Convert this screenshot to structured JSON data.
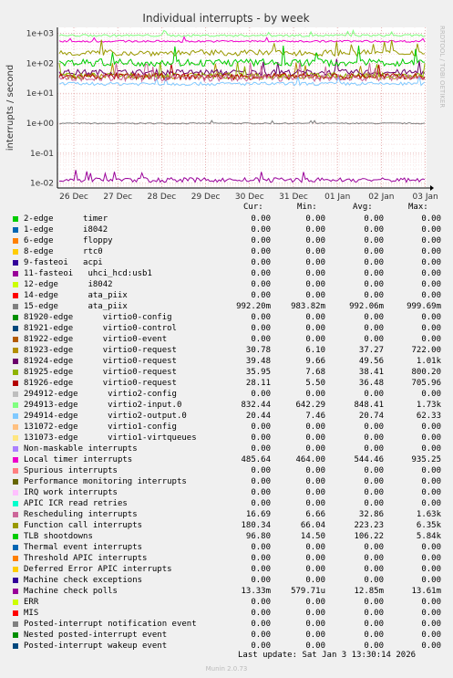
{
  "chart_data": {
    "type": "line",
    "title": "Individual interrupts - by week",
    "ylabel": "interrupts / second",
    "yscale": "log",
    "ylim": [
      0.007,
      2000
    ],
    "yticks": [
      "1e+03",
      "1e+02",
      "1e+01",
      "1e+00",
      "1e-01",
      "1e-02"
    ],
    "xticks": [
      "26 Dec",
      "27 Dec",
      "28 Dec",
      "29 Dec",
      "30 Dec",
      "31 Dec",
      "01 Jan",
      "02 Jan",
      "03 Jan"
    ],
    "watermark": "RRDTOOL / TOBI OETIKER",
    "grid": true,
    "columns": [
      "Cur:",
      "Min:",
      "Avg:",
      "Max:"
    ],
    "series": [
      {
        "name": "2-edge      timer",
        "color": "#00cc00",
        "values": [
          "0.00",
          "0.00",
          "0.00",
          "0.00"
        ]
      },
      {
        "name": "1-edge      i8042",
        "color": "#0066b3",
        "values": [
          "0.00",
          "0.00",
          "0.00",
          "0.00"
        ]
      },
      {
        "name": "6-edge      floppy",
        "color": "#ff8000",
        "values": [
          "0.00",
          "0.00",
          "0.00",
          "0.00"
        ]
      },
      {
        "name": "8-edge      rtc0",
        "color": "#ffcc00",
        "values": [
          "0.00",
          "0.00",
          "0.00",
          "0.00"
        ]
      },
      {
        "name": "9-fasteoi   acpi",
        "color": "#330099",
        "values": [
          "0.00",
          "0.00",
          "0.00",
          "0.00"
        ]
      },
      {
        "name": "11-fasteoi   uhci_hcd:usb1",
        "color": "#990099",
        "values": [
          "0.00",
          "0.00",
          "0.00",
          "0.00"
        ]
      },
      {
        "name": "12-edge      i8042",
        "color": "#ccff00",
        "values": [
          "0.00",
          "0.00",
          "0.00",
          "0.00"
        ]
      },
      {
        "name": "14-edge      ata_piix",
        "color": "#ff0000",
        "values": [
          "0.00",
          "0.00",
          "0.00",
          "0.00"
        ]
      },
      {
        "name": "15-edge      ata_piix",
        "color": "#808080",
        "values": [
          "992.20m",
          "983.82m",
          "992.06m",
          "999.69m"
        ]
      },
      {
        "name": "81920-edge      virtio0-config",
        "color": "#008f00",
        "values": [
          "0.00",
          "0.00",
          "0.00",
          "0.00"
        ]
      },
      {
        "name": "81921-edge      virtio0-control",
        "color": "#00487d",
        "values": [
          "0.00",
          "0.00",
          "0.00",
          "0.00"
        ]
      },
      {
        "name": "81922-edge      virtio0-event",
        "color": "#b35a00",
        "values": [
          "0.00",
          "0.00",
          "0.00",
          "0.00"
        ]
      },
      {
        "name": "81923-edge      virtio0-request",
        "color": "#b38f00",
        "values": [
          "30.78",
          "6.10",
          "37.27",
          "722.00"
        ]
      },
      {
        "name": "81924-edge      virtio0-request",
        "color": "#6b006b",
        "values": [
          "39.48",
          "9.66",
          "49.56",
          "1.01k"
        ]
      },
      {
        "name": "81925-edge      virtio0-request",
        "color": "#8fb300",
        "values": [
          "35.95",
          "7.68",
          "38.41",
          "800.20"
        ]
      },
      {
        "name": "81926-edge      virtio0-request",
        "color": "#b30000",
        "values": [
          "28.11",
          "5.50",
          "36.48",
          "705.96"
        ]
      },
      {
        "name": "294912-edge      virtio2-config",
        "color": "#bebebe",
        "values": [
          "0.00",
          "0.00",
          "0.00",
          "0.00"
        ]
      },
      {
        "name": "294913-edge      virtio2-input.0",
        "color": "#80ff80",
        "values": [
          "832.44",
          "642.29",
          "848.41",
          "1.73k"
        ]
      },
      {
        "name": "294914-edge      virtio2-output.0",
        "color": "#80c9ff",
        "values": [
          "20.44",
          "7.46",
          "20.74",
          "62.33"
        ]
      },
      {
        "name": "131072-edge      virtio1-config",
        "color": "#ffc080",
        "values": [
          "0.00",
          "0.00",
          "0.00",
          "0.00"
        ]
      },
      {
        "name": "131073-edge      virtio1-virtqueues",
        "color": "#ffe680",
        "values": [
          "0.00",
          "0.00",
          "0.00",
          "0.00"
        ]
      },
      {
        "name": "Non-maskable interrupts",
        "color": "#aa80ff",
        "values": [
          "0.00",
          "0.00",
          "0.00",
          "0.00"
        ]
      },
      {
        "name": "Local timer interrupts",
        "color": "#ee00cc",
        "values": [
          "485.64",
          "464.00",
          "544.46",
          "935.25"
        ]
      },
      {
        "name": "Spurious interrupts",
        "color": "#ff8080",
        "values": [
          "0.00",
          "0.00",
          "0.00",
          "0.00"
        ]
      },
      {
        "name": "Performance monitoring interrupts",
        "color": "#666600",
        "values": [
          "0.00",
          "0.00",
          "0.00",
          "0.00"
        ]
      },
      {
        "name": "IRQ work interrupts",
        "color": "#ffbfff",
        "values": [
          "0.00",
          "0.00",
          "0.00",
          "0.00"
        ]
      },
      {
        "name": "APIC ICR read retries",
        "color": "#00ffcc",
        "values": [
          "0.00",
          "0.00",
          "0.00",
          "0.00"
        ]
      },
      {
        "name": "Rescheduling interrupts",
        "color": "#cc6699",
        "values": [
          "16.69",
          "6.66",
          "32.86",
          "1.63k"
        ]
      },
      {
        "name": "Function call interrupts",
        "color": "#999900",
        "values": [
          "180.34",
          "66.04",
          "223.23",
          "6.35k"
        ]
      },
      {
        "name": "TLB shootdowns",
        "color": "#00cc00",
        "values": [
          "96.80",
          "14.50",
          "106.22",
          "5.84k"
        ]
      },
      {
        "name": "Thermal event interrupts",
        "color": "#0066b3",
        "values": [
          "0.00",
          "0.00",
          "0.00",
          "0.00"
        ]
      },
      {
        "name": "Threshold APIC interrupts",
        "color": "#ff8000",
        "values": [
          "0.00",
          "0.00",
          "0.00",
          "0.00"
        ]
      },
      {
        "name": "Deferred Error APIC interrupts",
        "color": "#ffcc00",
        "values": [
          "0.00",
          "0.00",
          "0.00",
          "0.00"
        ]
      },
      {
        "name": "Machine check exceptions",
        "color": "#330099",
        "values": [
          "0.00",
          "0.00",
          "0.00",
          "0.00"
        ]
      },
      {
        "name": "Machine check polls",
        "color": "#990099",
        "values": [
          "13.33m",
          "579.71u",
          "12.85m",
          "13.61m"
        ]
      },
      {
        "name": "ERR",
        "color": "#ccff00",
        "values": [
          "0.00",
          "0.00",
          "0.00",
          "0.00"
        ]
      },
      {
        "name": "MIS",
        "color": "#ff0000",
        "values": [
          "0.00",
          "0.00",
          "0.00",
          "0.00"
        ]
      },
      {
        "name": "Posted-interrupt notification event",
        "color": "#808080",
        "values": [
          "0.00",
          "0.00",
          "0.00",
          "0.00"
        ]
      },
      {
        "name": "Nested posted-interrupt event",
        "color": "#008f00",
        "values": [
          "0.00",
          "0.00",
          "0.00",
          "0.00"
        ]
      },
      {
        "name": "Posted-interrupt wakeup event",
        "color": "#00487d",
        "values": [
          "0.00",
          "0.00",
          "0.00",
          "0.00"
        ]
      }
    ]
  },
  "footer": {
    "last_update": "Last update: Sat Jan  3 13:30:14 2026",
    "munin_version": "Munin 2.0.73"
  }
}
